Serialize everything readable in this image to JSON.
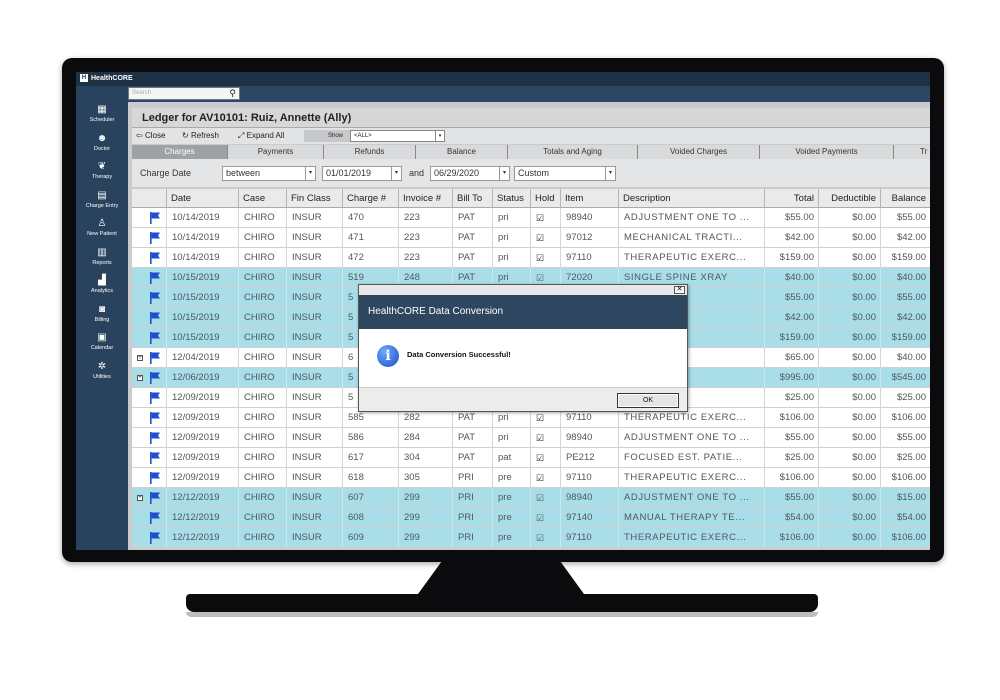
{
  "app": {
    "name": "HealthCORE"
  },
  "search": {
    "placeholder": "Search"
  },
  "sidebar": {
    "items": [
      {
        "label": "Scheduler",
        "icon": "calendar-grid-icon"
      },
      {
        "label": "Doctor",
        "icon": "doctor-icon"
      },
      {
        "label": "Therapy",
        "icon": "therapy-hands-icon"
      },
      {
        "label": "Charge Entry",
        "icon": "document-icon"
      },
      {
        "label": "New Patient",
        "icon": "add-person-icon"
      },
      {
        "label": "Reports",
        "icon": "report-icon"
      },
      {
        "label": "Analytics",
        "icon": "analytics-chart-icon"
      },
      {
        "label": "Billing",
        "icon": "billing-icon"
      },
      {
        "label": "Calendar",
        "icon": "calendar-icon"
      },
      {
        "label": "Utilities",
        "icon": "gear-icon"
      }
    ]
  },
  "ledger": {
    "title": "Ledger for AV10101: Ruiz, Annette (Ally)"
  },
  "toolbar": {
    "close_label": "Close",
    "refresh_label": "Refresh",
    "expand_label": "Expand All",
    "show_label": "Show",
    "show_value": "<ALL>"
  },
  "tabs": [
    {
      "label": "Charges",
      "active": true
    },
    {
      "label": "Payments"
    },
    {
      "label": "Refunds"
    },
    {
      "label": "Balance"
    },
    {
      "label": "Totals and Aging"
    },
    {
      "label": "Voided Charges"
    },
    {
      "label": "Voided Payments"
    },
    {
      "label": "Tr"
    }
  ],
  "filter": {
    "label": "Charge Date",
    "operator": "between",
    "from": "01/01/2019",
    "and_label": "and",
    "to": "06/29/2020",
    "range": "Custom"
  },
  "grid": {
    "columns": [
      "Date",
      "Case",
      "Fin Class",
      "Charge #",
      "Invoice #",
      "Bill To",
      "Status",
      "Hold",
      "Item",
      "Description",
      "Total",
      "Deductible",
      "Balance"
    ],
    "rows": [
      {
        "highlight": false,
        "expander": false,
        "date": "10/14/2019",
        "case": "CHIRO",
        "fin_class": "INSUR",
        "charge": "470",
        "invoice": "223",
        "bill_to": "PAT",
        "status": "pri",
        "hold": "☑",
        "item": "98940",
        "description": "ADJUSTMENT  ONE  TO ...",
        "total": "$55.00",
        "deductible": "$0.00",
        "balance": "$55.00"
      },
      {
        "highlight": false,
        "expander": false,
        "date": "10/14/2019",
        "case": "CHIRO",
        "fin_class": "INSUR",
        "charge": "471",
        "invoice": "223",
        "bill_to": "PAT",
        "status": "pri",
        "hold": "☑",
        "item": "97012",
        "description": "MECHANICAL  TRACTI...",
        "total": "$42.00",
        "deductible": "$0.00",
        "balance": "$42.00"
      },
      {
        "highlight": false,
        "expander": false,
        "date": "10/14/2019",
        "case": "CHIRO",
        "fin_class": "INSUR",
        "charge": "472",
        "invoice": "223",
        "bill_to": "PAT",
        "status": "pri",
        "hold": "☑",
        "item": "97110",
        "description": "THERAPEUTIC  EXERC...",
        "total": "$159.00",
        "deductible": "$0.00",
        "balance": "$159.00"
      },
      {
        "highlight": true,
        "expander": false,
        "date": "10/15/2019",
        "case": "CHIRO",
        "fin_class": "INSUR",
        "charge": "519",
        "invoice": "248",
        "bill_to": "PAT",
        "status": "pri",
        "hold": "☑",
        "item": "72020",
        "description": "SINGLE SPINE XRAY",
        "total": "$40.00",
        "deductible": "$0.00",
        "balance": "$40.00"
      },
      {
        "highlight": true,
        "expander": false,
        "date": "10/15/2019",
        "case": "CHIRO",
        "fin_class": "INSUR",
        "charge": "5",
        "invoice": "",
        "bill_to": "",
        "status": "",
        "hold": "",
        "item": "",
        "description": "ONE  TO ...",
        "total": "$55.00",
        "deductible": "$0.00",
        "balance": "$55.00"
      },
      {
        "highlight": true,
        "expander": false,
        "date": "10/15/2019",
        "case": "CHIRO",
        "fin_class": "INSUR",
        "charge": "5",
        "invoice": "",
        "bill_to": "",
        "status": "",
        "hold": "",
        "item": "",
        "description": "TRACTI...",
        "total": "$42.00",
        "deductible": "$0.00",
        "balance": "$42.00"
      },
      {
        "highlight": true,
        "expander": false,
        "date": "10/15/2019",
        "case": "CHIRO",
        "fin_class": "INSUR",
        "charge": "5",
        "invoice": "",
        "bill_to": "",
        "status": "",
        "hold": "",
        "item": "",
        "description": "EXERC...",
        "total": "$159.00",
        "deductible": "$0.00",
        "balance": "$159.00"
      },
      {
        "highlight": false,
        "expander": true,
        "date": "12/04/2019",
        "case": "CHIRO",
        "fin_class": "INSUR",
        "charge": "6",
        "invoice": "",
        "bill_to": "",
        "status": "",
        "hold": "",
        "item": "",
        "description": "THREE...",
        "total": "$65.00",
        "deductible": "$0.00",
        "balance": "$40.00"
      },
      {
        "highlight": true,
        "expander": true,
        "date": "12/06/2019",
        "case": "CHIRO",
        "fin_class": "INSUR",
        "charge": "5",
        "invoice": "",
        "bill_to": "",
        "status": "",
        "hold": "",
        "item": "",
        "description": "CE",
        "total": "$995.00",
        "deductible": "$0.00",
        "balance": "$545.00"
      },
      {
        "highlight": false,
        "expander": false,
        "date": "12/09/2019",
        "case": "CHIRO",
        "fin_class": "INSUR",
        "charge": "5",
        "invoice": "",
        "bill_to": "",
        "status": "",
        "hold": "",
        "item": "",
        "description": "EST.  PATIE...",
        "total": "$25.00",
        "deductible": "$0.00",
        "balance": "$25.00"
      },
      {
        "highlight": false,
        "expander": false,
        "date": "12/09/2019",
        "case": "CHIRO",
        "fin_class": "INSUR",
        "charge": "585",
        "invoice": "282",
        "bill_to": "PAT",
        "status": "pri",
        "hold": "☑",
        "item": "97110",
        "description": "THERAPEUTIC  EXERC...",
        "total": "$106.00",
        "deductible": "$0.00",
        "balance": "$106.00"
      },
      {
        "highlight": false,
        "expander": false,
        "date": "12/09/2019",
        "case": "CHIRO",
        "fin_class": "INSUR",
        "charge": "586",
        "invoice": "284",
        "bill_to": "PAT",
        "status": "pri",
        "hold": "☑",
        "item": "98940",
        "description": "ADJUSTMENT  ONE  TO ...",
        "total": "$55.00",
        "deductible": "$0.00",
        "balance": "$55.00"
      },
      {
        "highlight": false,
        "expander": false,
        "date": "12/09/2019",
        "case": "CHIRO",
        "fin_class": "INSUR",
        "charge": "617",
        "invoice": "304",
        "bill_to": "PAT",
        "status": "pat",
        "hold": "☑",
        "item": "PE212",
        "description": "FOCUSED  EST.  PATIE...",
        "total": "$25.00",
        "deductible": "$0.00",
        "balance": "$25.00"
      },
      {
        "highlight": false,
        "expander": false,
        "date": "12/09/2019",
        "case": "CHIRO",
        "fin_class": "INSUR",
        "charge": "618",
        "invoice": "305",
        "bill_to": "PRI",
        "status": "pre",
        "hold": "☑",
        "item": "97110",
        "description": "THERAPEUTIC  EXERC...",
        "total": "$106.00",
        "deductible": "$0.00",
        "balance": "$106.00"
      },
      {
        "highlight": true,
        "expander": true,
        "date": "12/12/2019",
        "case": "CHIRO",
        "fin_class": "INSUR",
        "charge": "607",
        "invoice": "299",
        "bill_to": "PRI",
        "status": "pre",
        "hold": "☑",
        "item": "98940",
        "description": "ADJUSTMENT  ONE  TO ...",
        "total": "$55.00",
        "deductible": "$0.00",
        "balance": "$15.00"
      },
      {
        "highlight": true,
        "expander": false,
        "date": "12/12/2019",
        "case": "CHIRO",
        "fin_class": "INSUR",
        "charge": "608",
        "invoice": "299",
        "bill_to": "PRI",
        "status": "pre",
        "hold": "☑",
        "item": "97140",
        "description": "MANUAL  THERAPY  TE...",
        "total": "$54.00",
        "deductible": "$0.00",
        "balance": "$54.00"
      },
      {
        "highlight": true,
        "expander": false,
        "date": "12/12/2019",
        "case": "CHIRO",
        "fin_class": "INSUR",
        "charge": "609",
        "invoice": "299",
        "bill_to": "PRI",
        "status": "pre",
        "hold": "☑",
        "item": "97110",
        "description": "THERAPEUTIC  EXERC...",
        "total": "$106.00",
        "deductible": "$0.00",
        "balance": "$106.00"
      }
    ]
  },
  "dialog": {
    "title": "HealthCORE Data Conversion",
    "message": "Data Conversion Successful!",
    "ok_label": "OK",
    "close_glyph": "✕"
  },
  "colors": {
    "sidebar": "#29435e",
    "dialog_header": "#2e4660",
    "row_highlight": "#a9dde8",
    "flag": "#1d4fd0"
  }
}
